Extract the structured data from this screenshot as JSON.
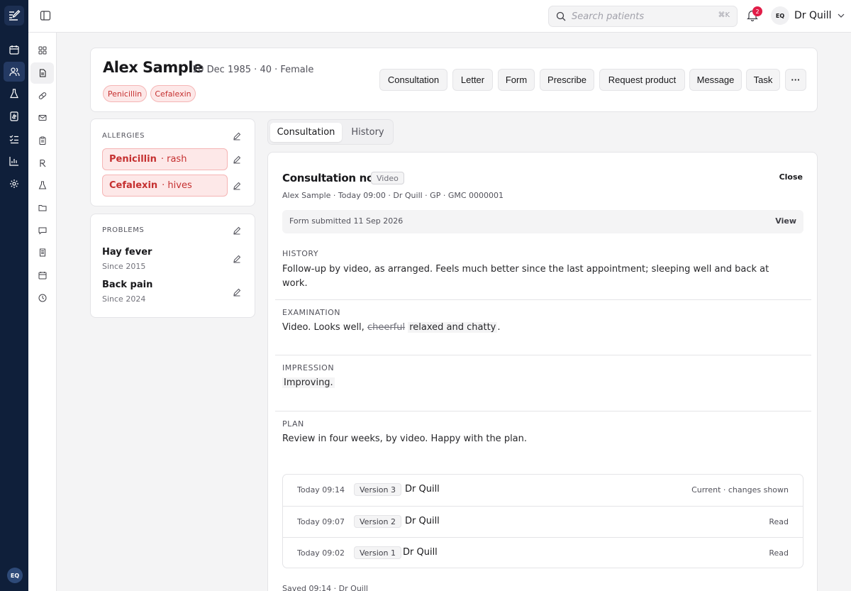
{
  "user": {
    "initials": "EQ",
    "name": "Dr Quill"
  },
  "search": {
    "placeholder": "Search patients",
    "shortcut": "⌘K"
  },
  "notifications": {
    "count": "2"
  },
  "patient": {
    "name": "Alex Sample",
    "meta": "10 Dec 1985 · 40 · Female",
    "allergy_chips": [
      "Penicillin",
      "Cefalexin"
    ]
  },
  "actions": [
    "Consultation",
    "Letter",
    "Form",
    "Prescribe",
    "Request product",
    "Message",
    "Task"
  ],
  "more_label": "···",
  "allergies": {
    "title": "ALLERGIES",
    "items": [
      {
        "name": "Penicillin",
        "reaction": "· rash"
      },
      {
        "name": "Cefalexin",
        "reaction": "· hives"
      }
    ]
  },
  "problems": {
    "title": "PROBLEMS",
    "items": [
      {
        "name": "Hay fever",
        "since": "Since 2015"
      },
      {
        "name": "Back pain",
        "since": "Since 2024"
      }
    ]
  },
  "tabs": [
    "Consultation",
    "History"
  ],
  "note": {
    "title": "Consultation note",
    "tag": "Video",
    "close_label": "Close",
    "meta": "Alex Sample · Today 09:00 · Dr Quill · GP · GMC 0000001",
    "form_banner": {
      "text": "Form submitted 11 Sep 2026",
      "action": "View"
    },
    "history": {
      "label": "HISTORY",
      "line1": "Follow-up by video, as arranged. Feels much better since the last appointment; sleeping well and back at",
      "line2": "work."
    },
    "examination": {
      "label": "EXAMINATION",
      "prefix": "Video. Looks well, ",
      "removed": "cheerful",
      "added": "relaxed and chatty",
      "suffix": "."
    },
    "impression": {
      "label": "IMPRESSION",
      "text": "Improving."
    },
    "plan": {
      "label": "PLAN",
      "text": "Review in four weeks, by video. Happy with the plan."
    },
    "versions": [
      {
        "time": "Today 09:14",
        "label": "Version 3",
        "author": "Dr Quill",
        "status": "Current · changes shown"
      },
      {
        "time": "Today 09:07",
        "label": "Version 2",
        "author": "Dr Quill",
        "status": "Read"
      },
      {
        "time": "Today 09:02",
        "label": "Version 1",
        "author": "Dr Quill",
        "status": "Read"
      }
    ],
    "saved": "Saved 09:14 · Dr Quill"
  },
  "colors": {
    "rail": "#0f1f3a",
    "allergy_bg": "#fde8e8",
    "allergy_text": "#c53030",
    "badge": "#e11d48"
  },
  "icons": {
    "rail": [
      "calendar-icon",
      "users-icon",
      "flask-icon",
      "ledger-icon",
      "checklist-icon",
      "bar-chart-icon",
      "gear-icon"
    ],
    "subnav": [
      "grid-icon",
      "document-icon",
      "pill-icon",
      "mail-icon",
      "clipboard-icon",
      "rx-icon",
      "flask-icon",
      "folder-icon",
      "chat-icon",
      "receipt-icon",
      "calendar-icon",
      "clock-icon"
    ]
  }
}
